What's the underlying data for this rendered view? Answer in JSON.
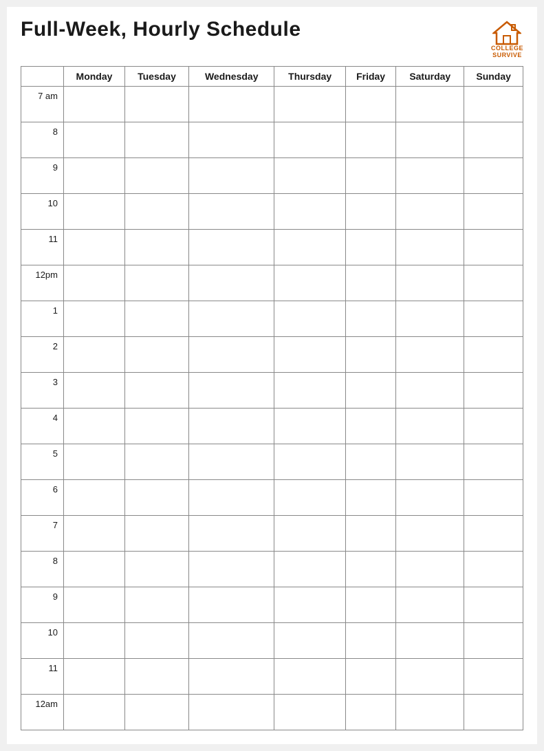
{
  "title": "Full-Week, Hourly Schedule",
  "logo": {
    "line1": "COLLEGE",
    "line2": "SURVIVE"
  },
  "days": [
    "Monday",
    "Tuesday",
    "Wednesday",
    "Thursday",
    "Friday",
    "Saturday",
    "Sunday"
  ],
  "hours": [
    "7 am",
    "8",
    "9",
    "10",
    "11",
    "12pm",
    "1",
    "2",
    "3",
    "4",
    "5",
    "6",
    "7",
    "8",
    "9",
    "10",
    "11",
    "12am"
  ]
}
